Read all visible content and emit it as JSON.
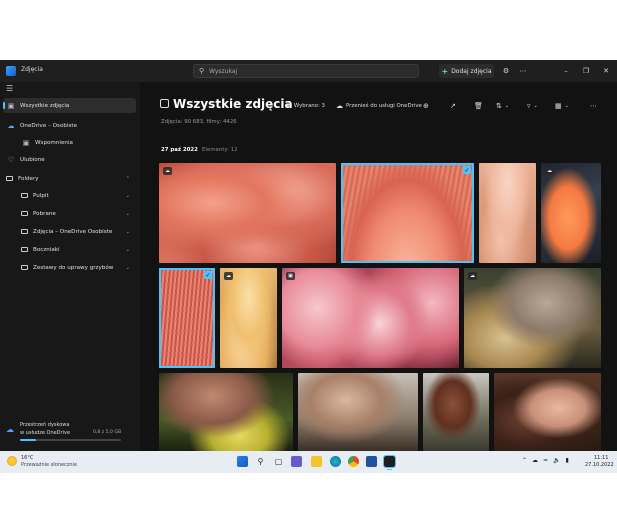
{
  "app": {
    "title": "Zdjęcia"
  },
  "search": {
    "placeholder": "Wyszukaj"
  },
  "toolbar": {
    "add_photos": "Dodaj zdjęcia"
  },
  "sidebar": {
    "all_photos": "Wszystkie zdjęcia",
    "onedrive": "OneDrive – Osobiste",
    "memories": "Wspomnienia",
    "favorites": "Ulubione",
    "folders": "Foldery",
    "folder_items": [
      "Pulpit",
      "Pobrane",
      "Zdjęcia – OneDrive Osobiste",
      "Boczniaki",
      "Zestawy do uprawy grzybów"
    ],
    "storage_title": "Przestrzeń dyskowa",
    "storage_subtitle": "w usłudze OneDrive",
    "storage_size": "0,8 z 5,0 GB",
    "storage_fraction": 0.16
  },
  "main": {
    "title": "Wszystkie zdjęcia",
    "subtitle": "Zdjęcia: 90 683, filmy: 4426",
    "selected_label": "Wybrano: 3",
    "move_label": "Przenieś do usługi OneDrive",
    "date_label": "27 paź 2022",
    "count_label": "Elementy: 12"
  },
  "taskbar": {
    "weather_temp": "16°C",
    "weather_desc": "Przeważnie słonecznie",
    "time": "11:11",
    "date": "27.10.2022"
  },
  "colors": {
    "accent": "#4cc2ff",
    "background": "#121212",
    "sidebar": "#181818"
  }
}
